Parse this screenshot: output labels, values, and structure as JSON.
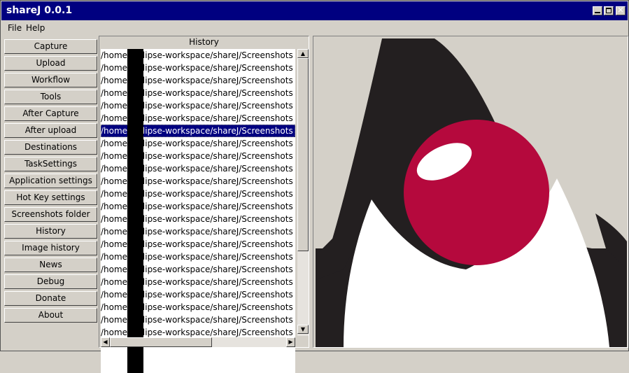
{
  "window": {
    "title": "shareJ 0.0.1"
  },
  "menu": {
    "file": "File",
    "help": "Help"
  },
  "sidebar": {
    "items": [
      {
        "label": "Capture"
      },
      {
        "label": "Upload"
      },
      {
        "label": "Workflow"
      },
      {
        "label": "Tools"
      },
      {
        "label": "After Capture"
      },
      {
        "label": "After upload"
      },
      {
        "label": "Destinations"
      },
      {
        "label": "TaskSettings"
      },
      {
        "label": "Application settings"
      },
      {
        "label": "Hot Key settings"
      },
      {
        "label": "Screenshots folder"
      },
      {
        "label": "History"
      },
      {
        "label": "Image history"
      },
      {
        "label": "News"
      },
      {
        "label": "Debug"
      },
      {
        "label": "Donate"
      },
      {
        "label": "About"
      }
    ]
  },
  "history": {
    "title": "History",
    "selected_index": 6,
    "rows": [
      "/home/ eclipse-workspace/shareJ/Screenshots",
      "/home/ eclipse-workspace/shareJ/Screenshots",
      "/home/ eclipse-workspace/shareJ/Screenshots",
      "/home/ eclipse-workspace/shareJ/Screenshots",
      "/home/ eclipse-workspace/shareJ/Screenshots",
      "/home/ eclipse-workspace/shareJ/Screenshots",
      "/home/ eclipse-workspace/shareJ/Screenshots",
      "/home/ eclipse-workspace/shareJ/Screenshots",
      "/home/ eclipse-workspace/shareJ/Screenshots",
      "/home/ eclipse-workspace/shareJ/Screenshots",
      "/home/ eclipse-workspace/shareJ/Screenshots",
      "/home/ eclipse-workspace/shareJ/Screenshots",
      "/home/ eclipse-workspace/shareJ/Screenshots",
      "/home/ eclipse-workspace/shareJ/Screenshots",
      "/home/ eclipse-workspace/shareJ/Screenshots",
      "/home/ eclipse-workspace/shareJ/Screenshots",
      "/home/ eclipse-workspace/shareJ/Screenshots",
      "/home/ eclipse-workspace/shareJ/Screenshots",
      "/home/ eclipse-workspace/shareJ/Screenshots",
      "/home/ eclipse-workspace/shareJ/Screenshots",
      "/home/ eclipse-workspace/shareJ/Screenshots",
      "/home/ eclipse-workspace/shareJ/Screenshots",
      "/home/ eclipse-workspace/shareJ/Screenshots"
    ]
  },
  "preview": {
    "image": "duke-mascot-icon"
  },
  "colors": {
    "titlebar": "#000080",
    "selection": "#000080",
    "duke_black": "#231f20",
    "duke_red": "#b5093d",
    "background": "#d4d0c8"
  }
}
